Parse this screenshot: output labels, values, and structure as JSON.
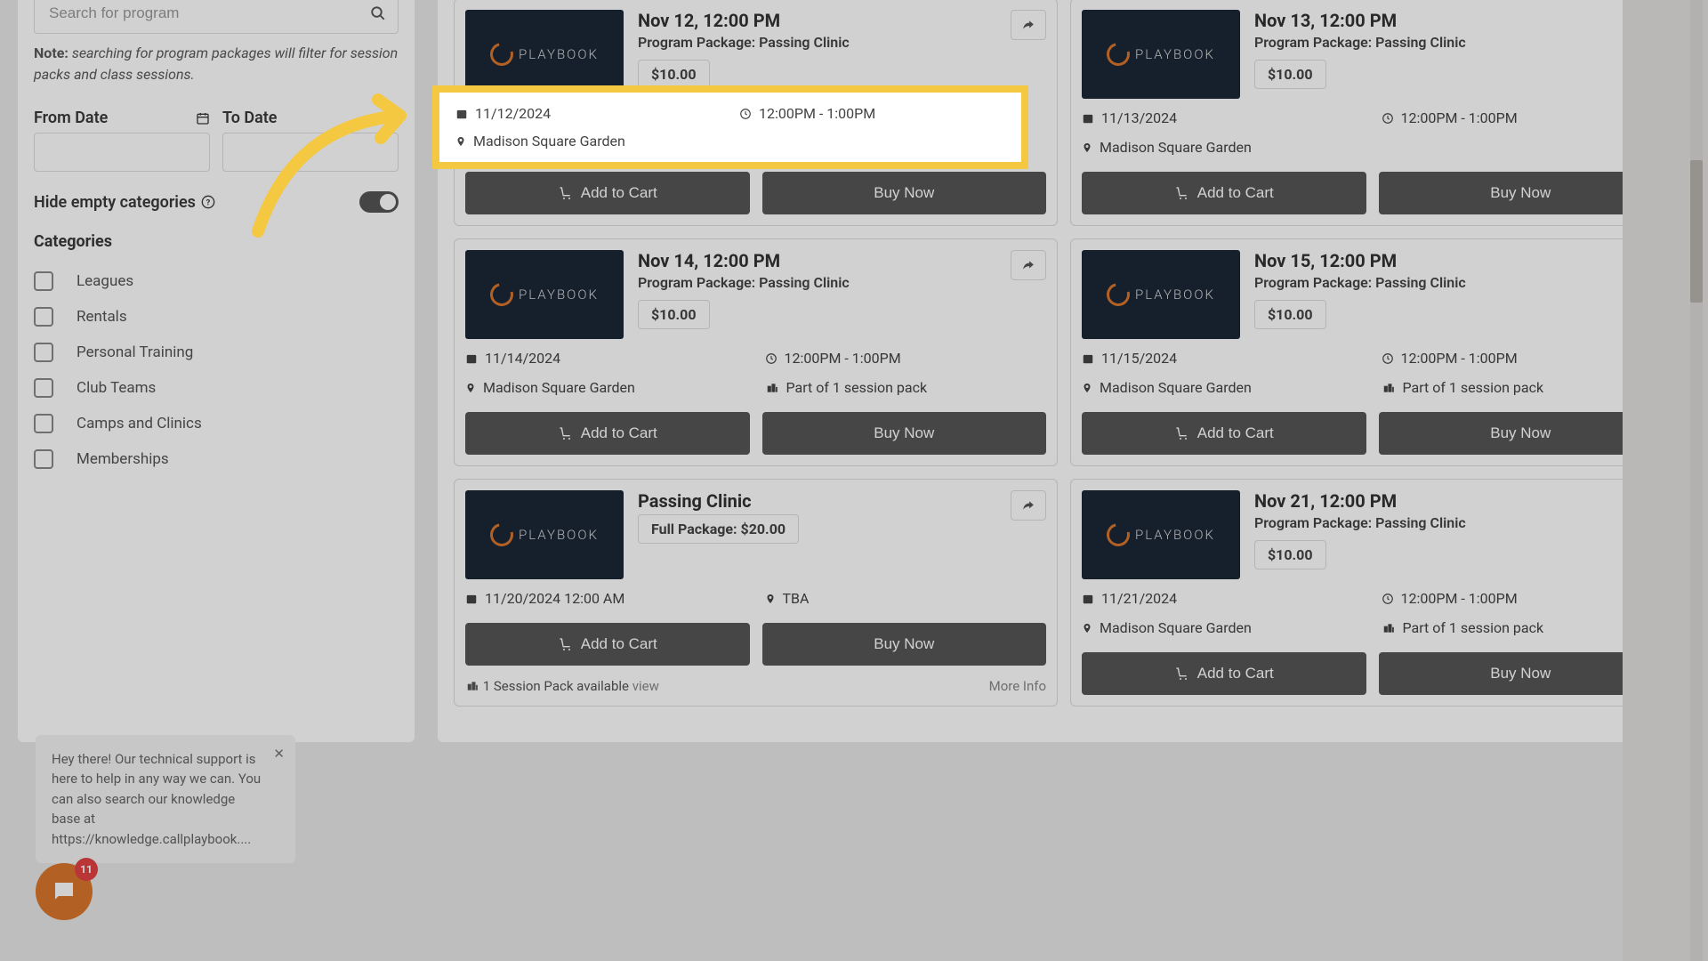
{
  "search": {
    "placeholder": "Search for program",
    "note_bold": "Note:",
    "note_text": " searching for program packages will filter for session packs and class sessions."
  },
  "dates": {
    "from_label": "From Date",
    "to_label": "To Date"
  },
  "hide_categories_label": "Hide empty categories",
  "categories_title": "Categories",
  "categories": [
    {
      "label": "Leagues"
    },
    {
      "label": "Rentals"
    },
    {
      "label": "Personal Training"
    },
    {
      "label": "Club Teams"
    },
    {
      "label": "Camps and Clinics"
    },
    {
      "label": "Memberships"
    }
  ],
  "thumb_brand": "PLAYBOOK",
  "buttons": {
    "add_to_cart": "Add to Cart",
    "buy_now": "Buy Now"
  },
  "highlight": {
    "date": "11/12/2024",
    "time": "12:00PM - 1:00PM",
    "location": "Madison Square Garden"
  },
  "cards": [
    {
      "title": "Nov 12, 12:00 PM",
      "subtitle": "Program Package: Passing Clinic",
      "price": "$10.00",
      "date": "11/12/2024",
      "time": "12:00PM - 1:00PM",
      "location": "Madison Square Garden"
    },
    {
      "title": "Nov 13, 12:00 PM",
      "subtitle": "Program Package: Passing Clinic",
      "price": "$10.00",
      "date": "11/13/2024",
      "time": "12:00PM - 1:00PM",
      "location": "Madison Square Garden"
    },
    {
      "title": "Nov 14, 12:00 PM",
      "subtitle": "Program Package: Passing Clinic",
      "price": "$10.00",
      "date": "11/14/2024",
      "time": "12:00PM - 1:00PM",
      "location": "Madison Square Garden",
      "pack": "Part of 1 session pack"
    },
    {
      "title": "Nov 15, 12:00 PM",
      "subtitle": "Program Package: Passing Clinic",
      "price": "$10.00",
      "date": "11/15/2024",
      "time": "12:00PM - 1:00PM",
      "location": "Madison Square Garden",
      "pack": "Part of 1 session pack"
    },
    {
      "title": "Passing Clinic",
      "subtitle_alt": "Full Package: $20.00",
      "date_full": "11/20/2024 12:00 AM",
      "location": "TBA",
      "foot_left": "1 Session Pack available",
      "foot_view": "view",
      "foot_right": "More Info"
    },
    {
      "title": "Nov 21, 12:00 PM",
      "subtitle": "Program Package: Passing Clinic",
      "price": "$10.00",
      "date": "11/21/2024",
      "time": "12:00PM - 1:00PM",
      "location": "Madison Square Garden",
      "pack": "Part of 1 session pack"
    }
  ],
  "support": {
    "text": "Hey there! Our technical support is here to help in any way we can. You can also search our knowledge base at https://knowledge.callplaybook....",
    "badge": "11"
  }
}
